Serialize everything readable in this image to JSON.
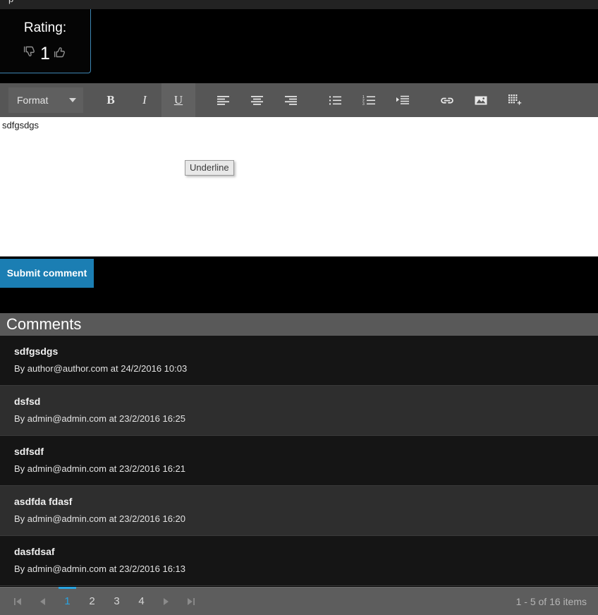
{
  "top_strip": {
    "cut_text": "p"
  },
  "rating": {
    "label": "Rating:",
    "count": "1",
    "thumb_down": "👎",
    "thumb_up": "👍"
  },
  "editor": {
    "toolbar": {
      "format_label": "Format",
      "bold_label": "B",
      "italic_label": "I",
      "underline_label": "U",
      "align_left_name": "align-left-icon",
      "align_center_name": "align-center-icon",
      "align_right_name": "align-right-icon",
      "bullet_list_name": "bullet-list-icon",
      "numbered_list_name": "numbered-list-icon",
      "indent_name": "indent-icon",
      "link_name": "link-icon",
      "image_name": "image-icon",
      "table_name": "table-icon"
    },
    "content": "sdfgsdgs",
    "tooltip": "Underline"
  },
  "submit": {
    "label": "Submit comment"
  },
  "comments": {
    "header": "Comments",
    "items": [
      {
        "title": "sdfgsdgs",
        "meta": "By author@author.com at 24/2/2016 10:03"
      },
      {
        "title": "dsfsd",
        "meta": "By admin@admin.com at 23/2/2016 16:25"
      },
      {
        "title": "sdfsdf",
        "meta": "By admin@admin.com at 23/2/2016 16:21"
      },
      {
        "title": "asdfda fdasf",
        "meta": "By admin@admin.com at 23/2/2016 16:20"
      },
      {
        "title": "dasfdsaf",
        "meta": "By admin@admin.com at 23/2/2016 16:13"
      }
    ]
  },
  "pager": {
    "first_glyph": "⏮",
    "prev_glyph": "◀",
    "next_glyph": "▶",
    "last_glyph": "⏭",
    "pages": [
      "1",
      "2",
      "3",
      "4"
    ],
    "active_page": "1",
    "status": "1 - 5 of 16 items"
  },
  "colors": {
    "accent_blue": "#1b7eb3",
    "pager_active": "#29a3e0",
    "toolbar_bg": "#565656",
    "header_bg": "#595959"
  }
}
